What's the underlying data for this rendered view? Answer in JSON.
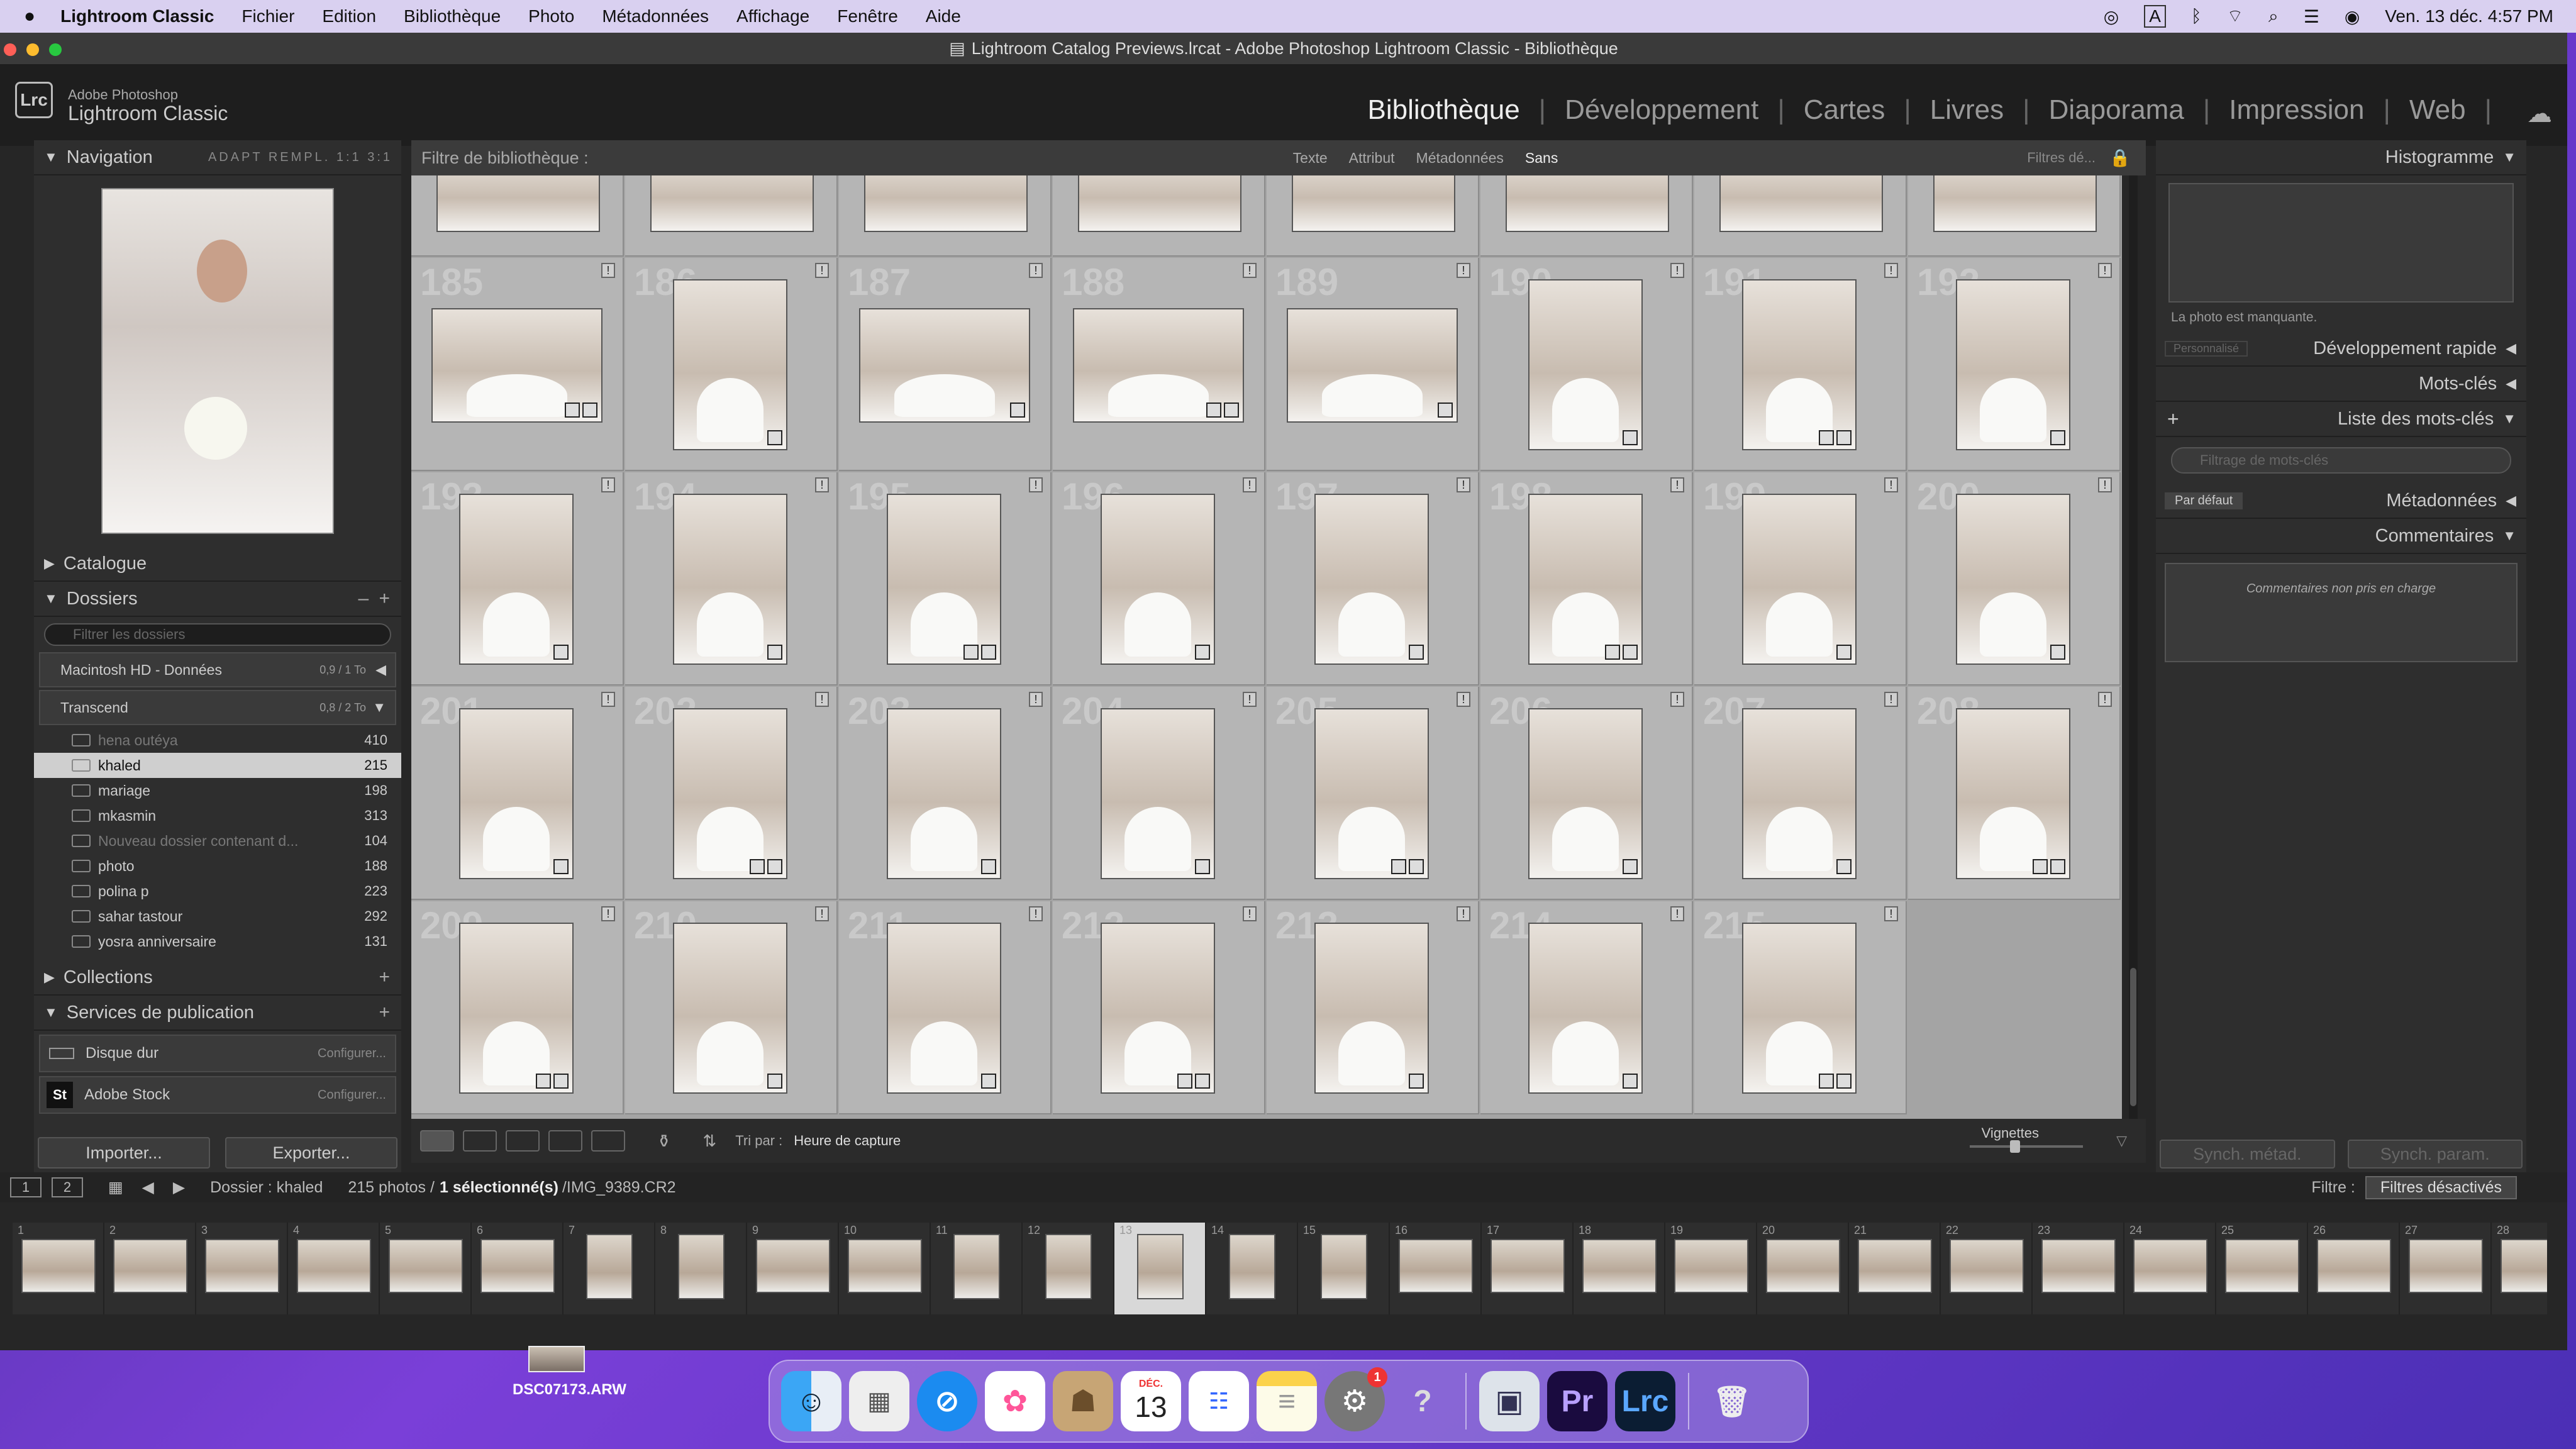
{
  "colors": {
    "accent": "#c8c8c8",
    "grid_bg": "#a4a4a4",
    "panel": "#2e2e2e"
  },
  "menubar": {
    "apple": "",
    "app": "Lightroom Classic",
    "items": [
      "Fichier",
      "Edition",
      "Bibliothèque",
      "Photo",
      "Métadonnées",
      "Affichage",
      "Fenêtre",
      "Aide"
    ],
    "clock": "Ven. 13 déc.  4:57 PM"
  },
  "window": {
    "title": "Lightroom Catalog Previews.lrcat - Adobe Photoshop Lightroom Classic - Bibliothèque"
  },
  "brand": {
    "logo": "Lrc",
    "line1": "Adobe Photoshop",
    "line2": "Lightroom Classic"
  },
  "modules": [
    "Bibliothèque",
    "Développement",
    "Cartes",
    "Livres",
    "Diaporama",
    "Impression",
    "Web"
  ],
  "left": {
    "navigation": {
      "title": "Navigation",
      "options": "ADAPT  REMPL.  1:1  3:1"
    },
    "catalogue": "Catalogue",
    "dossiers": {
      "title": "Dossiers",
      "search_placeholder": "Filtrer les dossiers",
      "volumes": [
        {
          "name": "Macintosh HD - Données",
          "cap": "0,9 / 1 To"
        },
        {
          "name": "Transcend",
          "cap": "0,8 / 2 To"
        }
      ],
      "folders": [
        {
          "name": "hena outéya",
          "count": "410"
        },
        {
          "name": "khaled",
          "count": "215"
        },
        {
          "name": "mariage",
          "count": "198"
        },
        {
          "name": "mkasmin",
          "count": "313"
        },
        {
          "name": "Nouveau dossier contenant d...",
          "count": "104"
        },
        {
          "name": "photo",
          "count": "188"
        },
        {
          "name": "polina p",
          "count": "223"
        },
        {
          "name": "sahar tastour",
          "count": "292"
        },
        {
          "name": "yosra anniversaire",
          "count": "131"
        }
      ]
    },
    "collections": "Collections",
    "publish": {
      "title": "Services de publication",
      "items": [
        {
          "label": "Disque dur",
          "cfg": "Configurer..."
        },
        {
          "label": "Adobe Stock",
          "cfg": "Configurer..."
        }
      ]
    },
    "import": "Importer...",
    "export": "Exporter..."
  },
  "filter": {
    "title": "Filtre de bibliothèque :",
    "tabs": [
      "Texte",
      "Attribut",
      "Métadonnées",
      "Sans"
    ],
    "preset": "Filtres dé..."
  },
  "grid": {
    "rows": [
      [
        "185",
        "186",
        "187",
        "188",
        "189",
        "190",
        "191",
        "192"
      ],
      [
        "193",
        "194",
        "195",
        "196",
        "197",
        "198",
        "199",
        "200"
      ],
      [
        "201",
        "202",
        "203",
        "204",
        "205",
        "206",
        "207",
        "208"
      ],
      [
        "209",
        "210",
        "211",
        "212",
        "213",
        "214",
        "215"
      ]
    ]
  },
  "toolbar": {
    "sort_label": "Tri par :",
    "sort_value": "Heure de capture",
    "thumbs_label": "Vignettes"
  },
  "right": {
    "histogram": "Histogramme",
    "missing": "La photo est manquante.",
    "quick_dev": "Développement rapide",
    "quick_dev_preset": "Personnalisé",
    "keywords": "Mots-clés",
    "keyword_list": "Liste des mots-clés",
    "kw_search": "Filtrage de mots-clés",
    "metadata": "Métadonnées",
    "metadata_preset": "Par défaut",
    "comments": "Commentaires",
    "comments_text": "Commentaires non pris en charge",
    "sync_meta": "Synch. métad.",
    "sync_params": "Synch. param."
  },
  "filmstrip": {
    "pages": [
      "1",
      "2"
    ],
    "folder": "Dossier : khaled",
    "count": "215 photos /",
    "selected": "1 sélectionné(s)",
    "file": "/IMG_9389.CR2",
    "filter_label": "Filtre :",
    "filter_value": "Filtres désactivés",
    "frames": [
      "1",
      "2",
      "3",
      "4",
      "5",
      "6",
      "7",
      "8",
      "9",
      "10",
      "11",
      "12",
      "13",
      "14",
      "15",
      "16",
      "17",
      "18",
      "19",
      "20",
      "21",
      "22",
      "23",
      "24",
      "25",
      "26",
      "27",
      "28"
    ]
  },
  "desktop": {
    "file": "DSC07173.ARW"
  },
  "dock": {
    "icons": [
      "finder-icon",
      "launchpad-icon",
      "safari-icon",
      "photos-icon",
      "contacts-icon",
      "calendar-icon",
      "reminders-icon",
      "notes-icon",
      "settings-icon",
      "help-icon",
      "preview-icon",
      "premiere-icon",
      "lightroom-icon",
      "trash-icon"
    ],
    "calendar_month": "DÉC.",
    "calendar_day": "13",
    "premiere": "Pr",
    "lightroom": "Lrc",
    "settings_badge": "1"
  }
}
